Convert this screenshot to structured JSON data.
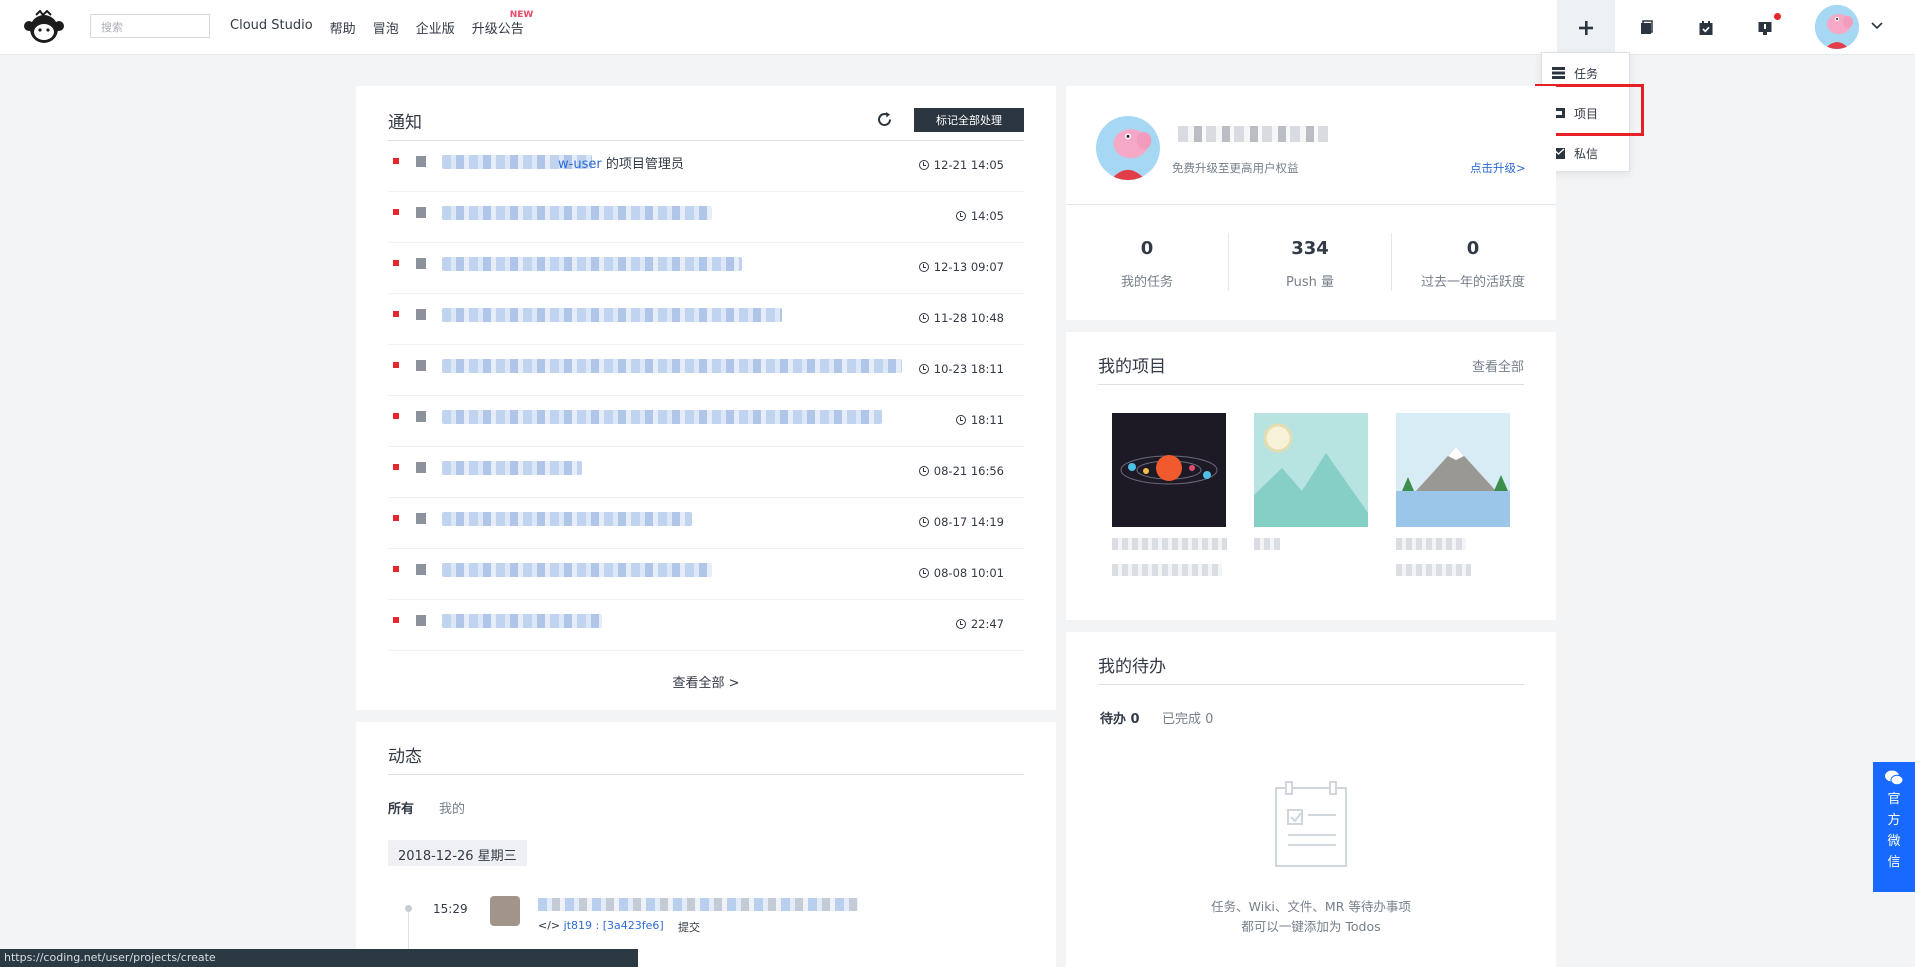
{
  "nav": {
    "search_placeholder": "搜索",
    "links": [
      "Cloud Studio",
      "帮助",
      "冒泡",
      "企业版",
      "升级公告"
    ],
    "new_badge": "NEW"
  },
  "dropdown": {
    "items": [
      {
        "label": "任务",
        "icon": "task-list-icon"
      },
      {
        "label": "项目",
        "icon": "project-folder-icon"
      },
      {
        "label": "私信",
        "icon": "mail-icon"
      }
    ]
  },
  "notifications": {
    "title": "通知",
    "mark_all": "标记全部处理",
    "first_item_suffix": "的项目管理员",
    "first_item_link_fragment": "w-user",
    "rows": [
      {
        "time": "12-21 14:05"
      },
      {
        "time": "14:05"
      },
      {
        "time": "12-13 09:07"
      },
      {
        "time": "11-28 10:48"
      },
      {
        "time": "10-23 18:11"
      },
      {
        "time": "18:11"
      },
      {
        "time": "08-21 16:56"
      },
      {
        "time": "08-17 14:19"
      },
      {
        "time": "08-08 10:01"
      },
      {
        "time": "22:47"
      }
    ],
    "view_all": "查看全部 >"
  },
  "activity": {
    "title": "动态",
    "tabs": [
      "所有",
      "我的"
    ],
    "date": "2018-12-26 星期三",
    "entry_time": "15:29",
    "entry_commit": "jt819 : [3a423fe6]",
    "entry_action": "提交"
  },
  "profile": {
    "upgrade_hint": "免费升级至更高用户权益",
    "upgrade_link": "点击升级>",
    "stats": [
      {
        "num": "0",
        "label": "我的任务"
      },
      {
        "num": "334",
        "label": "Push 量"
      },
      {
        "num": "0",
        "label": "过去一年的活跃度"
      }
    ]
  },
  "projects": {
    "title": "我的项目",
    "view_all": "查看全部"
  },
  "todos": {
    "title": "我的待办",
    "tab_pending": "待办 0",
    "tab_done": "已完成 0",
    "empty_line1": "任务、Wiki、文件、MR 等待办事项",
    "empty_line2": "都可以一键添加为 Todos"
  },
  "wechat": {
    "chars": [
      "官",
      "方",
      "微",
      "信"
    ]
  },
  "status_url": "https://coding.net/user/projects/create"
}
